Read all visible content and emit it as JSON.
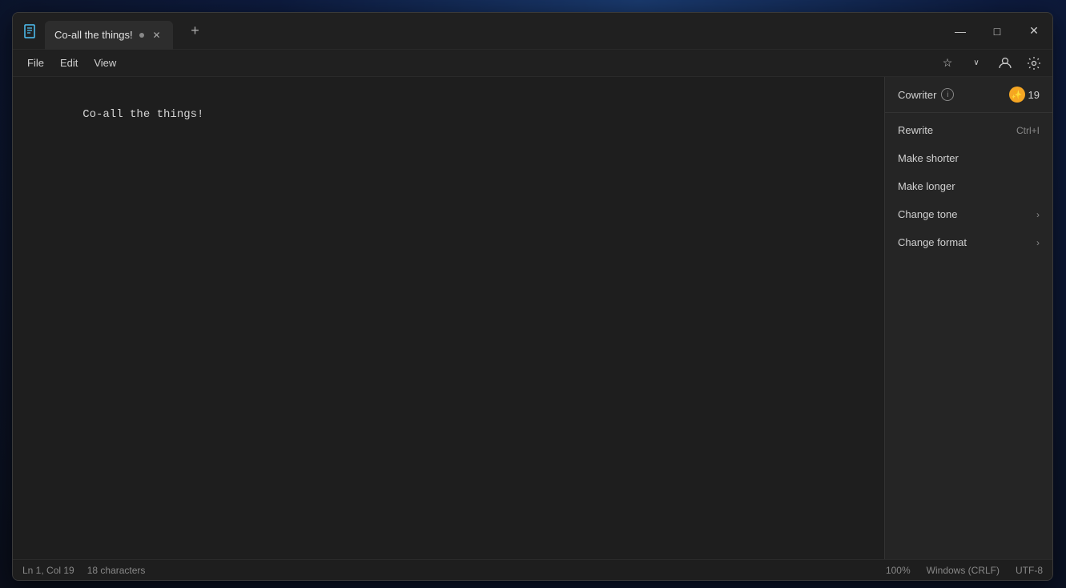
{
  "desktop": {
    "bg": "windows11"
  },
  "window": {
    "title": "Co-all the things!",
    "app_icon": "📝",
    "tab": {
      "label": "Co-all the things!",
      "modified": true
    },
    "controls": {
      "minimize": "—",
      "maximize": "□",
      "close": "✕"
    }
  },
  "menu_bar": {
    "items": [
      {
        "label": "File"
      },
      {
        "label": "Edit"
      },
      {
        "label": "View"
      }
    ],
    "actions": {
      "favorites": "☆",
      "favorites_dropdown": "∨",
      "user": "👤",
      "settings": "⚙"
    }
  },
  "editor": {
    "content": "Co-all the things!"
  },
  "cowriter": {
    "title": "Cowriter",
    "info": "i",
    "badge_icon": "🌟",
    "badge_count": "19",
    "menu_items": [
      {
        "label": "Rewrite",
        "shortcut": "Ctrl+I",
        "has_submenu": false
      },
      {
        "label": "Make shorter",
        "shortcut": "",
        "has_submenu": false
      },
      {
        "label": "Make longer",
        "shortcut": "",
        "has_submenu": false
      },
      {
        "label": "Change tone",
        "shortcut": "",
        "has_submenu": true
      },
      {
        "label": "Change format",
        "shortcut": "",
        "has_submenu": true
      }
    ]
  },
  "status_bar": {
    "line_col": "Ln 1, Col 19",
    "char_count": "18 characters",
    "zoom": "100%",
    "line_ending": "Windows (CRLF)",
    "encoding": "UTF-8"
  }
}
